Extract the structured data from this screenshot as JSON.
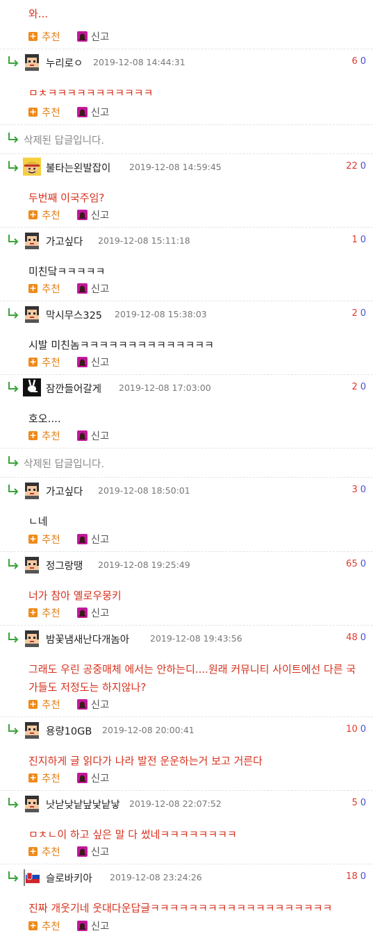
{
  "top": {
    "text": "와...",
    "recommend_label": "추천",
    "report_label": "신고"
  },
  "comments": [
    {
      "nick": "누리로ㅇ",
      "date": "2019-12-08 14:44:31",
      "up": "6",
      "down": "0",
      "text": "ㅁㅊㅋㅋㅋㅋㅋㅋㅋㅋㅋㅋㅋ",
      "color": "red",
      "avatar": "pixel"
    },
    {
      "deleted": true,
      "text": "삭제된 답글입니다."
    },
    {
      "nick": "불타는왼발잡이",
      "date": "2019-12-08 14:59:45",
      "up": "22",
      "down": "0",
      "text": "두번째 이국주임?",
      "color": "red",
      "avatar": "luffy"
    },
    {
      "nick": "가고싶다",
      "date": "2019-12-08 15:11:18",
      "up": "1",
      "down": "0",
      "text": "미친닼ㅋㅋㅋㅋㅋ",
      "color": "black",
      "avatar": "pixel"
    },
    {
      "nick": "막시무스325",
      "date": "2019-12-08 15:38:03",
      "up": "2",
      "down": "0",
      "text": "시발 미친놈ㅋㅋㅋㅋㅋㅋㅋㅋㅋㅋㅋㅋㅋㅋ",
      "color": "black",
      "avatar": "pixel"
    },
    {
      "nick": "잠깐들어갈게",
      "date": "2019-12-08 17:03:00",
      "up": "2",
      "down": "0",
      "text": "호오....",
      "color": "black",
      "avatar": "bunny"
    },
    {
      "deleted": true,
      "text": "삭제된 답글입니다."
    },
    {
      "nick": "가고싶다",
      "date": "2019-12-08 18:50:01",
      "up": "3",
      "down": "0",
      "text": "ㄴ네",
      "color": "black",
      "avatar": "pixel"
    },
    {
      "nick": "정그랑땡",
      "date": "2019-12-08 19:25:49",
      "up": "65",
      "down": "0",
      "text": "너가 참아 옐로우뭉키",
      "color": "red",
      "avatar": "pixel"
    },
    {
      "nick": "밤꽃냄새난다개놈아",
      "date": "2019-12-08 19:43:56",
      "up": "48",
      "down": "0",
      "text": "그래도 우린 공중매체 에서는 안하는디....원래 커뮤니티 사이트에선 다른 국가들도 저정도는 하지않나?",
      "color": "red",
      "avatar": "pixel"
    },
    {
      "nick": "용량10GB",
      "date": "2019-12-08 20:00:41",
      "up": "10",
      "down": "0",
      "text": "진지하게 글 읽다가 나라 발전 운운하는거 보고 거른다",
      "color": "red",
      "avatar": "pixel"
    },
    {
      "nick": "낫낟낮낱낲낯낱낳",
      "date": "2019-12-08 22:07:52",
      "up": "5",
      "down": "0",
      "text": "ㅁㅊㄴ이 하고 싶은 말 다 썼네ㅋㅋㅋㅋㅋㅋㅋㅋ",
      "color": "red",
      "avatar": "pixel"
    },
    {
      "nick": "슬로바키아",
      "date": "2019-12-08 23:24:26",
      "up": "18",
      "down": "0",
      "text": "진짜 개웃기네 웃대다운답글ㅋㅋㅋㅋㅋㅋㅋㅋㅋㅋㅋㅋㅋㅋㅋㅋㅋㅋㅋ",
      "color": "red",
      "avatar": "flag"
    }
  ],
  "labels": {
    "recommend": "추천",
    "report": "신고"
  },
  "colors": {
    "accent": "#e2821a",
    "upvote": "#e0372d",
    "downvote": "#4a4fcf",
    "reply_arrow": "#3aa33a"
  }
}
